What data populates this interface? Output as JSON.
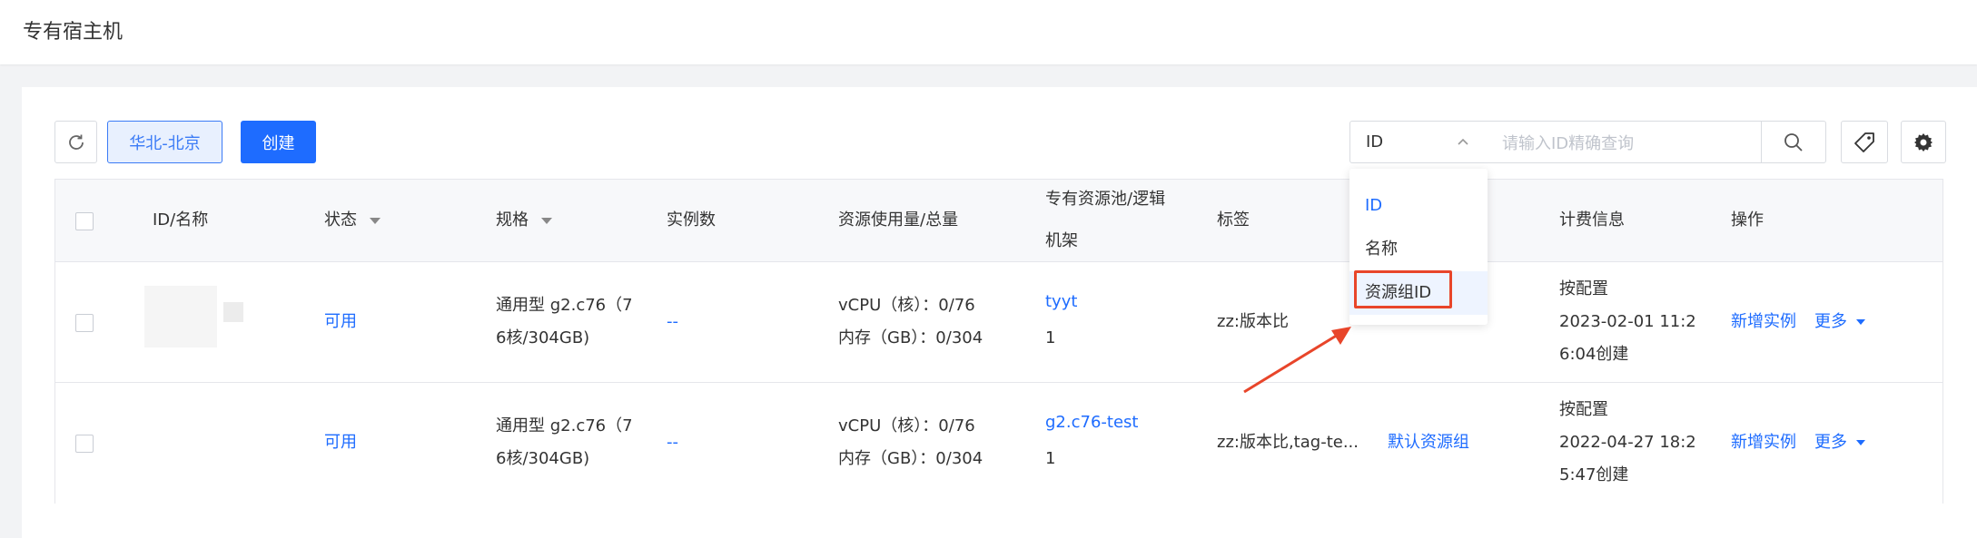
{
  "header": {
    "title": "专有宿主机"
  },
  "toolbar": {
    "region_label": "华北-北京",
    "create_label": "创建",
    "search_type_value": "ID",
    "search_placeholder": "请输入ID精确查询"
  },
  "search_dropdown": {
    "options": [
      "ID",
      "名称",
      "资源组ID"
    ],
    "selected": "ID",
    "highlighted": "资源组ID"
  },
  "table": {
    "columns": [
      "ID/名称",
      "状态",
      "规格",
      "实例数",
      "资源使用量/总量",
      "专有资源池/逻辑",
      "机架",
      "标签",
      "计费信息",
      "操作"
    ],
    "rows": [
      {
        "status": "可用",
        "spec_line1": "通用型 g2.c76（7",
        "spec_line2": "6核/304GB)",
        "instances": "--",
        "usage_cpu": "vCPU（核）：0/76",
        "usage_mem": "内存（GB）：0/304",
        "pool": "tyyt",
        "rack": "1",
        "tags": "zz:版本比",
        "resource_group": "",
        "billing_type": "按配置",
        "billing_time_line1": "2023-02-01 11:2",
        "billing_time_line2": "6:04创建",
        "action_new": "新增实例",
        "action_more": "更多"
      },
      {
        "status": "可用",
        "spec_line1": "通用型 g2.c76（7",
        "spec_line2": "6核/304GB)",
        "instances": "--",
        "usage_cpu": "vCPU（核）：0/76",
        "usage_mem": "内存（GB）：0/304",
        "pool": "g2.c76-test",
        "rack": "1",
        "tags": "zz:版本比,tag-te...",
        "resource_group": "默认资源组",
        "billing_type": "按配置",
        "billing_time_line1": "2022-04-27 18:2",
        "billing_time_line2": "5:47创建",
        "action_new": "新增实例",
        "action_more": "更多"
      }
    ]
  },
  "colors": {
    "primary": "#1e6cff",
    "annotation": "#e8452a"
  }
}
